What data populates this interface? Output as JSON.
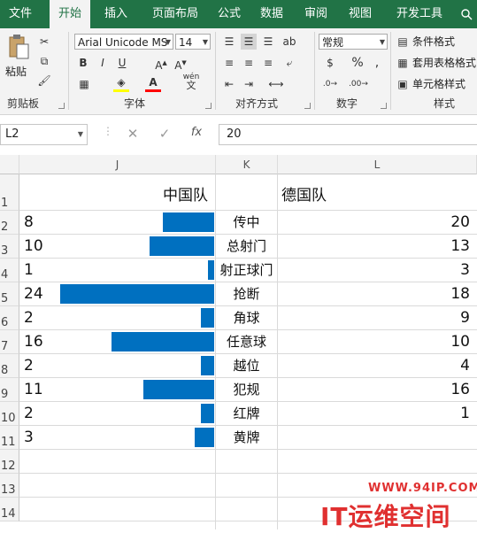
{
  "ribbon_tabs": [
    "文件",
    "开始",
    "插入",
    "页面布局",
    "公式",
    "数据",
    "审阅",
    "视图",
    "开发工具"
  ],
  "search_icon": "lightbulb-search-icon",
  "clipboard": {
    "paste_label": "粘贴",
    "group_label": "剪贴板"
  },
  "font": {
    "name": "Arial Unicode MS",
    "size": "14",
    "group_label": "字体",
    "phonetic_top": "wén",
    "phonetic_bottom": "文"
  },
  "alignment": {
    "group_label": "对齐方式"
  },
  "number": {
    "format": "常规",
    "group_label": "数字",
    "percent": "%",
    "comma": ","
  },
  "styles": {
    "conditional": "条件格式",
    "table": "套用表格格式",
    "cell": "单元格样式",
    "group_label": "样式"
  },
  "formula_bar": {
    "name_box": "L2",
    "cancel": "✕",
    "enter": "✓",
    "fx": "fx",
    "value": "20"
  },
  "columns": [
    "J",
    "K",
    "L"
  ],
  "rows": [
    "1",
    "2",
    "3",
    "4",
    "5",
    "6",
    "7",
    "8",
    "9",
    "10",
    "11",
    "12",
    "13",
    "14"
  ],
  "header": {
    "china": "中国队",
    "germany": "德国队"
  },
  "chart_data": {
    "type": "bar",
    "categories": [
      "传中",
      "总射门",
      "射正球门",
      "抢断",
      "角球",
      "任意球",
      "越位",
      "犯规",
      "红牌",
      "黄牌"
    ],
    "series": [
      {
        "name": "中国队",
        "values": [
          8,
          10,
          1,
          24,
          2,
          16,
          2,
          11,
          2,
          3
        ]
      },
      {
        "name": "德国队",
        "values": [
          20,
          13,
          3,
          18,
          9,
          10,
          4,
          16,
          1,
          ""
        ]
      }
    ]
  },
  "accent_colors": {
    "ribbon": "#217346",
    "bar": "#0070c0",
    "watermark": "#e03030"
  },
  "watermark": {
    "url": "WWW.94IP.COM",
    "text": "IT运维空间"
  }
}
